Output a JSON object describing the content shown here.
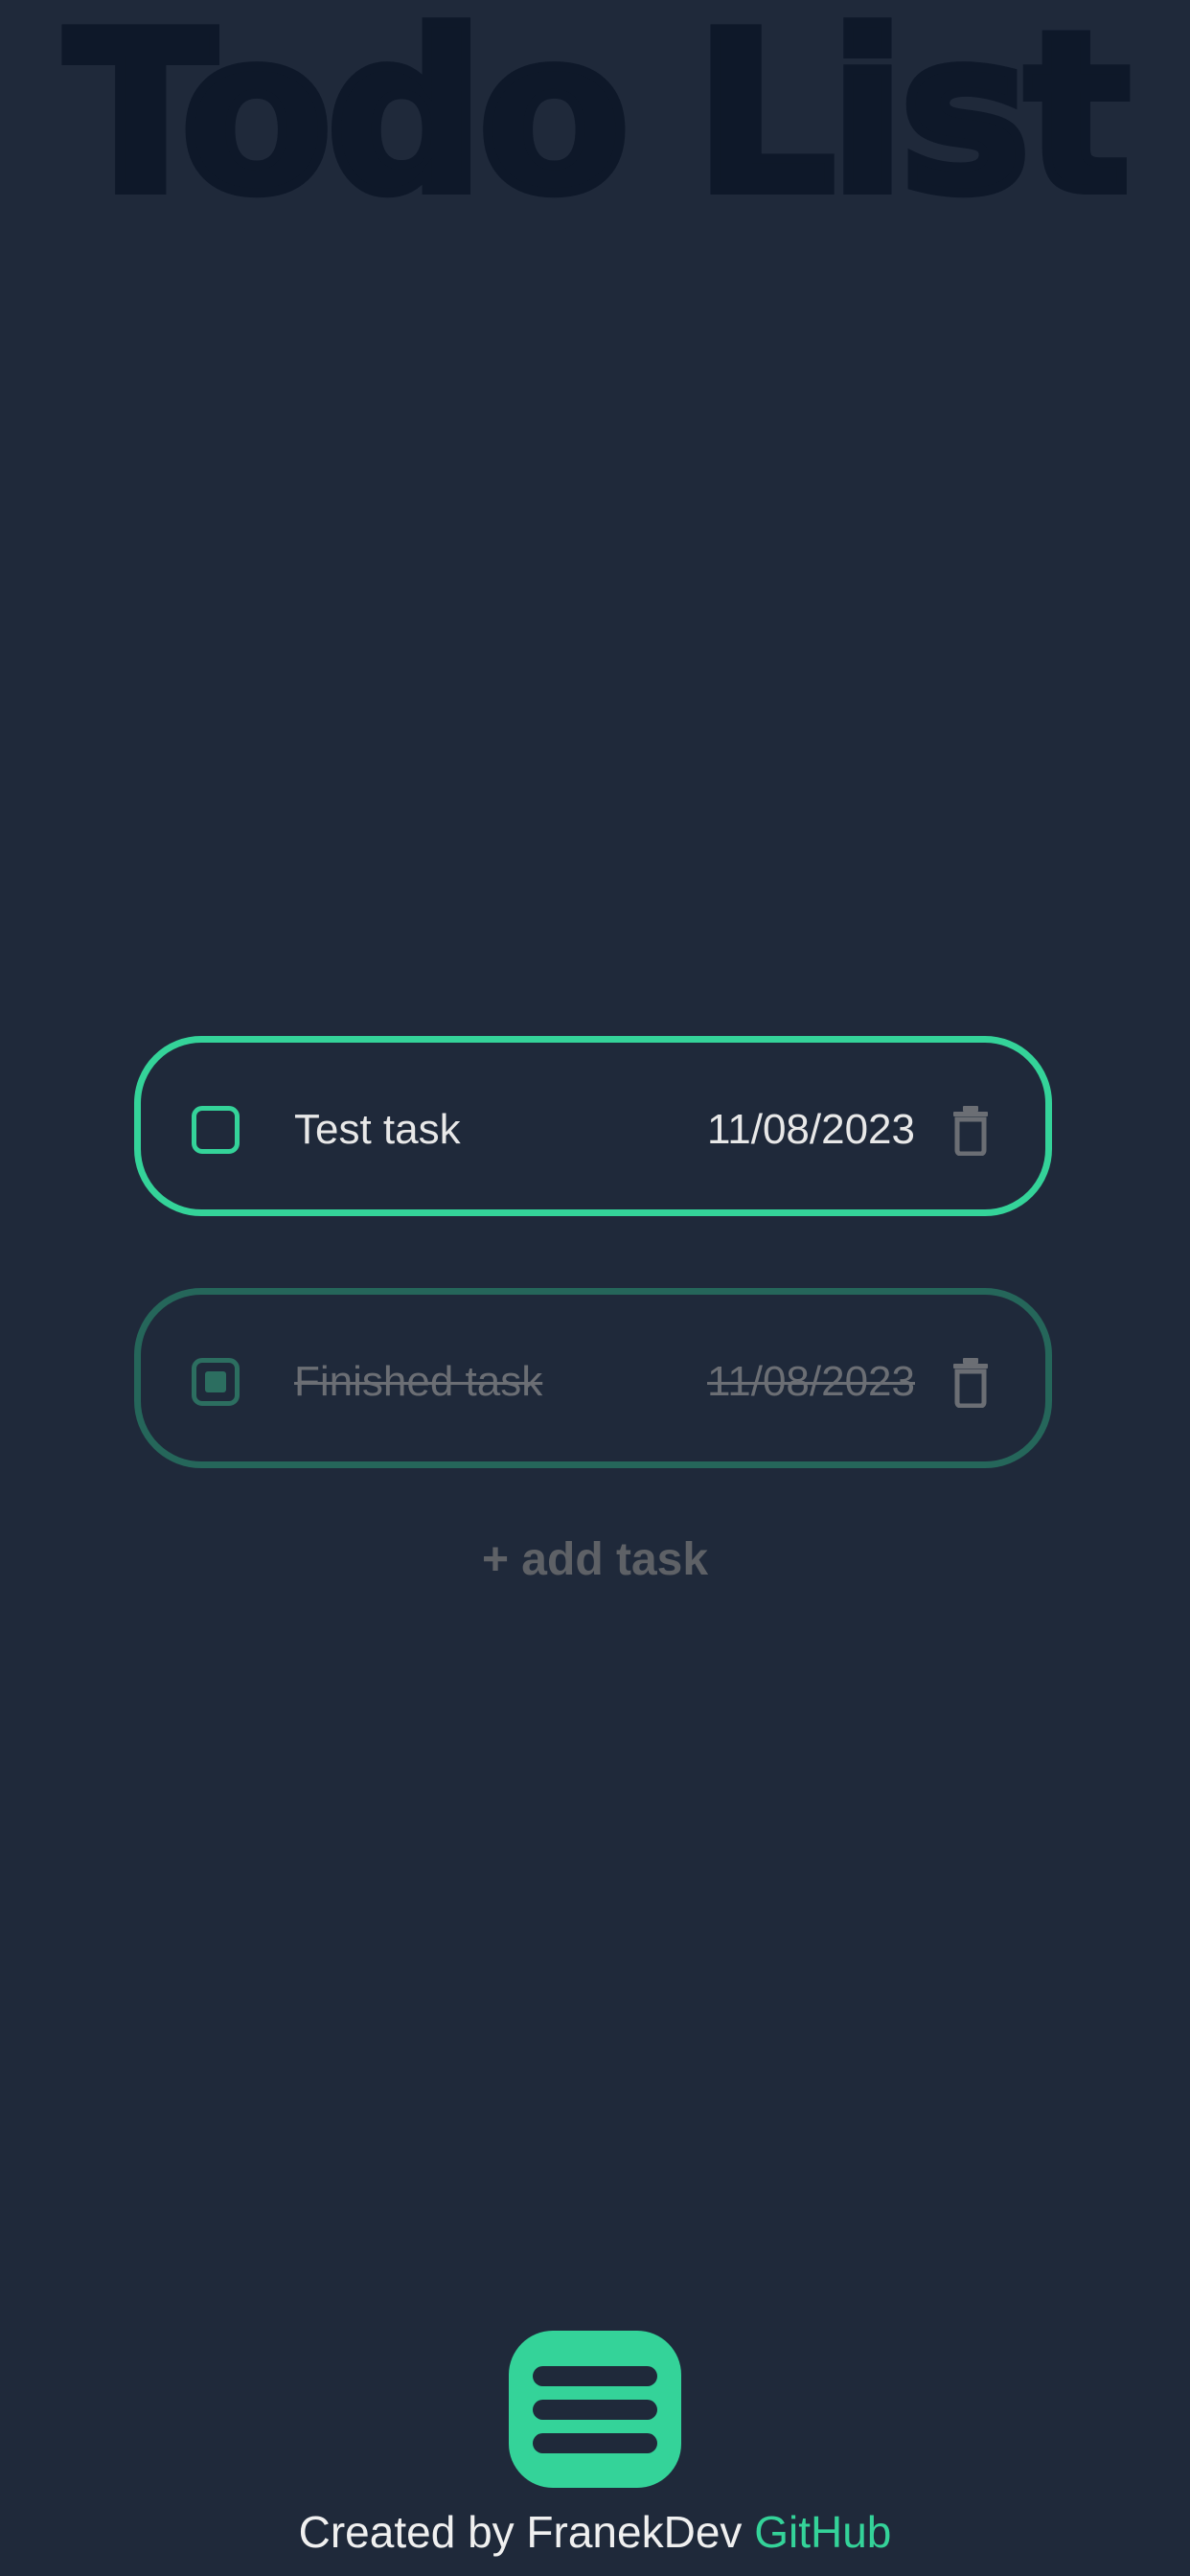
{
  "app": {
    "title": "Todo List"
  },
  "tasks": [
    {
      "label": "Test task",
      "date": "11/08/2023",
      "completed": false,
      "icon": "trash-icon"
    },
    {
      "label": "Finished task",
      "date": "11/08/2023",
      "completed": true,
      "icon": "trash-icon"
    }
  ],
  "add_task": {
    "label": "+ add task"
  },
  "menu_button": {
    "icon": "hamburger-menu-icon"
  },
  "footer": {
    "text": "Created by FranekDev",
    "link_label": "GitHub"
  },
  "colors": {
    "background": "#1f293a",
    "accent": "#34d399",
    "accent_dim": "#25665a",
    "title_shadow": "#0e1829",
    "muted_text": "#6b6e74"
  }
}
